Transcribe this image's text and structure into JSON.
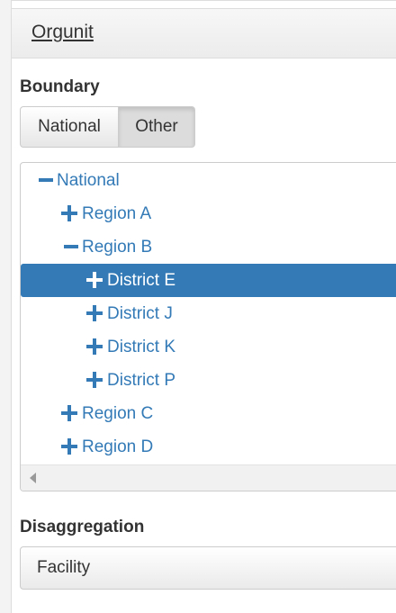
{
  "panel": {
    "title": "Orgunit"
  },
  "boundary": {
    "label": "Boundary",
    "options": [
      "National",
      "Other"
    ],
    "selected": "Other"
  },
  "tree": {
    "nodes": [
      {
        "label": "National",
        "expanded": true,
        "depth": 0
      },
      {
        "label": "Region A",
        "expanded": false,
        "depth": 1
      },
      {
        "label": "Region B",
        "expanded": true,
        "depth": 1
      },
      {
        "label": "District E",
        "expanded": false,
        "depth": 2,
        "selected": true
      },
      {
        "label": "District J",
        "expanded": false,
        "depth": 2
      },
      {
        "label": "District K",
        "expanded": false,
        "depth": 2
      },
      {
        "label": "District P",
        "expanded": false,
        "depth": 2
      },
      {
        "label": "Region C",
        "expanded": false,
        "depth": 1
      },
      {
        "label": "Region D",
        "expanded": false,
        "depth": 1
      }
    ]
  },
  "disaggregation": {
    "label": "Disaggregation",
    "value": "Facility"
  },
  "colors": {
    "accent": "#337ab7",
    "selected_bg": "#337ab7"
  }
}
